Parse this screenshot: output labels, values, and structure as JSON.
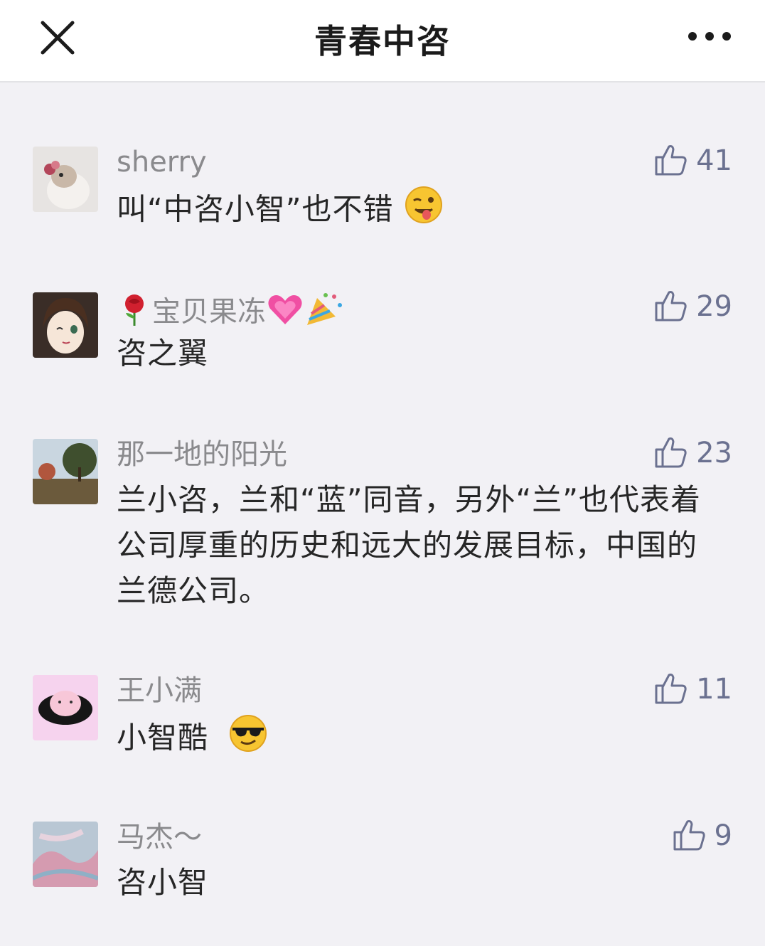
{
  "header": {
    "title": "青春中咨",
    "close_icon": "close-icon",
    "more_icon": "more-horizontal-icon"
  },
  "colors": {
    "background": "#f2f1f5",
    "header_bg": "#ffffff",
    "name": "#8a8a8d",
    "text": "#262626",
    "like": "#6b7190"
  },
  "comments": [
    {
      "name": "sherry",
      "text": "叫“中咨小智”也不错",
      "trailing_emoji": "winking-tongue-emoji",
      "likes": "41",
      "like_icon": "thumbs-up-icon"
    },
    {
      "name_prefix_emoji": "rose-emoji",
      "name": "宝贝果冻",
      "name_suffix_emojis": [
        "growing-heart-emoji",
        "party-popper-emoji"
      ],
      "text": "咨之翼",
      "likes": "29",
      "like_icon": "thumbs-up-icon"
    },
    {
      "name": "那一地的阳光",
      "text": "兰小咨，兰和“蓝”同音，另外“兰”也代表着公司厚重的历史和远大的发展目标，中国的兰德公司。",
      "likes": "23",
      "like_icon": "thumbs-up-icon"
    },
    {
      "name": "王小满",
      "text": "小智酷",
      "trailing_emoji": "sunglasses-emoji",
      "likes": "11",
      "like_icon": "thumbs-up-icon"
    },
    {
      "name": "马杰～",
      "text": "咨小智",
      "likes": "9",
      "like_icon": "thumbs-up-icon"
    }
  ]
}
